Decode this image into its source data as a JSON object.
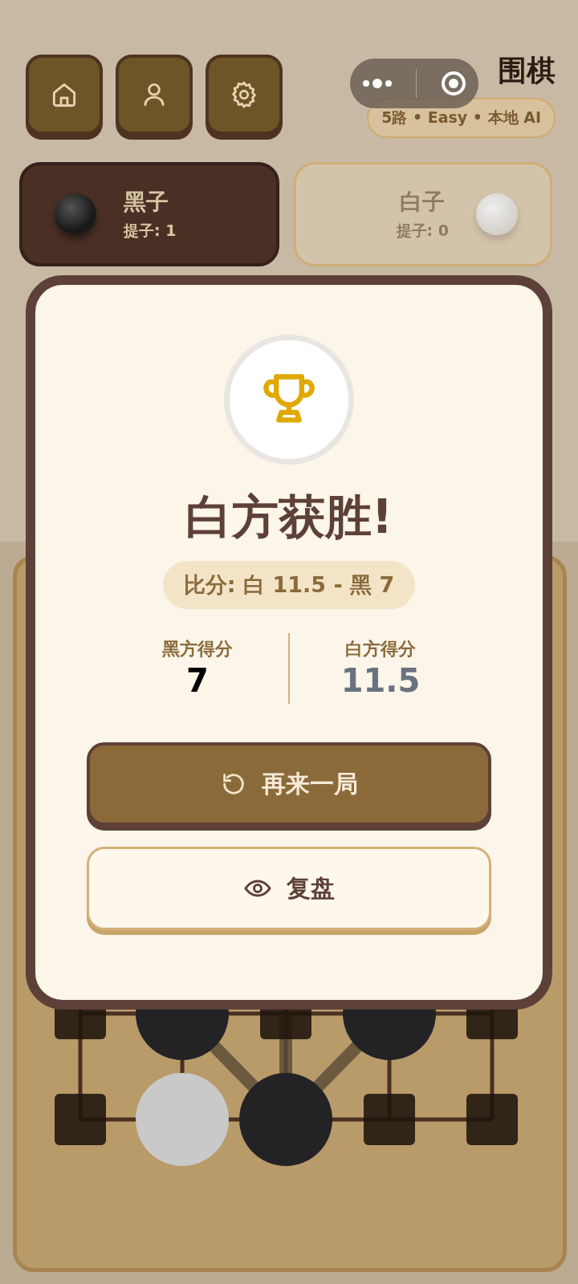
{
  "title": "围棋",
  "game_tag": "5路 • Easy •  本地 AI",
  "players": [
    {
      "kind": "black",
      "name": "黑子",
      "captures": "提子: 1",
      "selected": true
    },
    {
      "kind": "white",
      "name": "白子",
      "captures": "提子: 0",
      "selected": false
    }
  ],
  "board": {
    "rows": [
      [
        {
          "kind": "empty"
        },
        {
          "kind": "black"
        },
        {
          "kind": "empty"
        },
        {
          "kind": "black"
        },
        {
          "kind": "empty"
        }
      ],
      [
        {
          "kind": "empty"
        },
        {
          "kind": "white"
        },
        {
          "kind": "black"
        },
        {
          "kind": "empty"
        },
        {
          "kind": "empty"
        }
      ]
    ]
  },
  "result_dialog": {
    "title": "白方获胜!",
    "score_summary": "比分: 白 11.5 - 黑 7",
    "scores": [
      {
        "kind": "black",
        "label": "黑方得分",
        "value": "7"
      },
      {
        "kind": "white",
        "label": "白方得分",
        "value": "11.5"
      }
    ],
    "buttons": [
      {
        "kind": "primary",
        "label": "再来一局"
      },
      {
        "kind": "secondary",
        "label": "复盘"
      }
    ]
  }
}
